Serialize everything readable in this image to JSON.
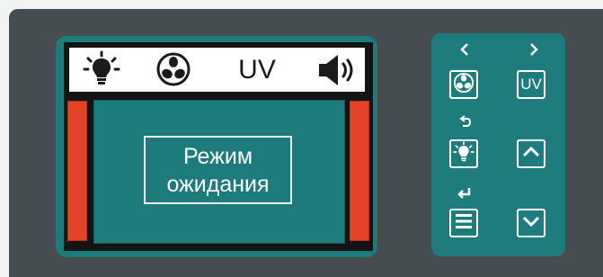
{
  "display": {
    "topbar": {
      "light_icon": "light-bulb-icon",
      "fan_icon": "fan-icon",
      "uv_label": "UV",
      "sound_icon": "speaker-icon"
    },
    "status_line1": "Режим",
    "status_line2": "ожидания"
  },
  "controls": {
    "prev_hint_icon": "chevron-left-icon",
    "next_hint_icon": "chevron-right-icon",
    "back_hint_icon": "undo-arrow-icon",
    "enter_hint_icon": "enter-arrow-icon",
    "buttons": {
      "fan": "fan-icon",
      "uv": "UV",
      "light": "light-bulb-icon",
      "up": "chevron-up-icon",
      "menu": "menu-icon",
      "down": "chevron-down-icon"
    }
  },
  "colors": {
    "device": "#454d50",
    "teal": "#1f7c7c",
    "indicator_red": "#e44329",
    "lcd_topbar": "#ffffff"
  }
}
